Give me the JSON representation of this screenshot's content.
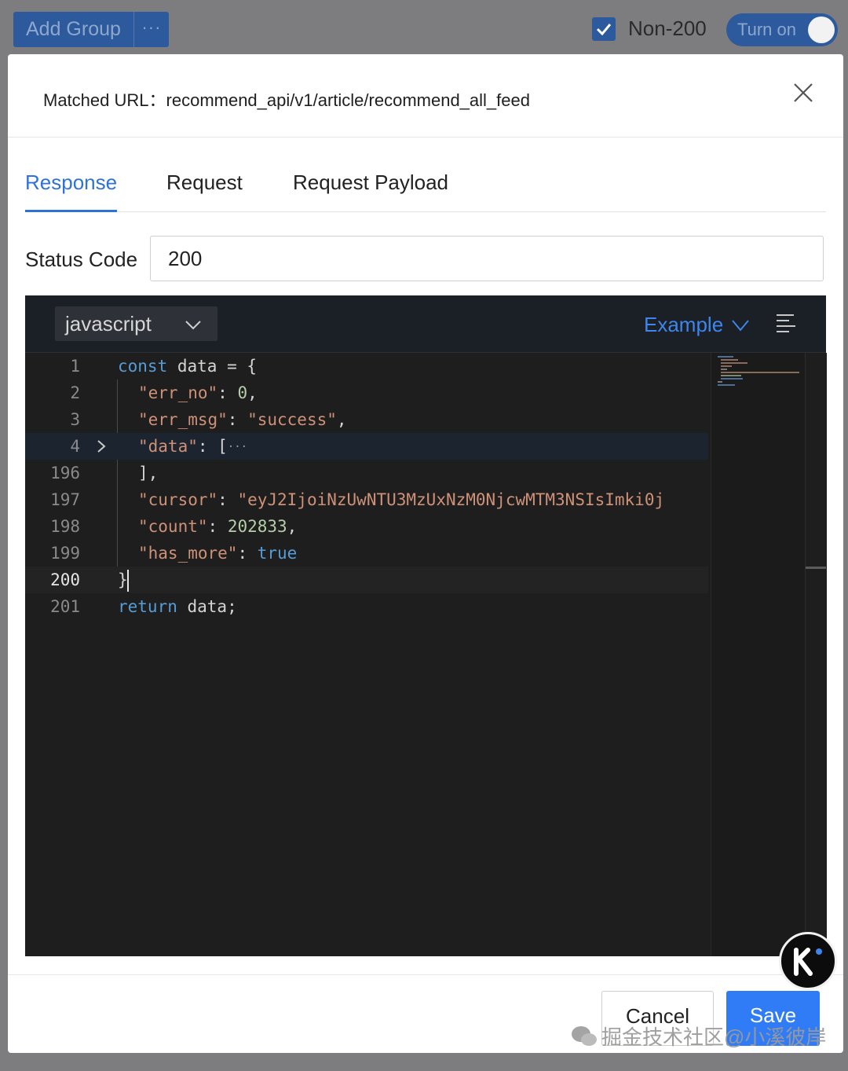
{
  "topbar": {
    "add_group_label": "Add Group",
    "more_label": "···",
    "non200_checked": true,
    "non200_label": "Non-200",
    "toggle_label": "Turn on"
  },
  "modal": {
    "matched_url_label": "Matched URL：",
    "matched_url_value": "recommend_api/v1/article/recommend_all_feed",
    "tabs": [
      {
        "label": "Response",
        "active": true
      },
      {
        "label": "Request",
        "active": false
      },
      {
        "label": "Request Payload",
        "active": false
      }
    ],
    "status_code_label": "Status Code",
    "status_code_value": "200",
    "editor": {
      "language": "javascript",
      "example_label": "Example",
      "lines": [
        {
          "n": "1",
          "text": "const data = {"
        },
        {
          "n": "2",
          "text": "\"err_no\": 0,"
        },
        {
          "n": "3",
          "text": "\"err_msg\": \"success\","
        },
        {
          "n": "4",
          "text": "\"data\": […"
        },
        {
          "n": "196",
          "text": "],"
        },
        {
          "n": "197",
          "text": "\"cursor\": \"eyJ2IjoiNzUwNTU3MzUxNzM0NjcwMTM3NSIsImki0j"
        },
        {
          "n": "198",
          "text": "\"count\": 202833,"
        },
        {
          "n": "199",
          "text": "\"has_more\": true"
        },
        {
          "n": "200",
          "text": "}"
        },
        {
          "n": "201",
          "text": "return data;"
        }
      ]
    },
    "footer": {
      "cancel_label": "Cancel",
      "save_label": "Save"
    }
  },
  "watermark": {
    "text": "掘金技术社区@小溪彼岸"
  },
  "colors": {
    "accent": "#2f72d8",
    "primary_button": "#2f7cf6",
    "editor_bg": "#1e1e1e",
    "keyword": "#569cd6",
    "string": "#ce9178",
    "number": "#b5cea8"
  }
}
